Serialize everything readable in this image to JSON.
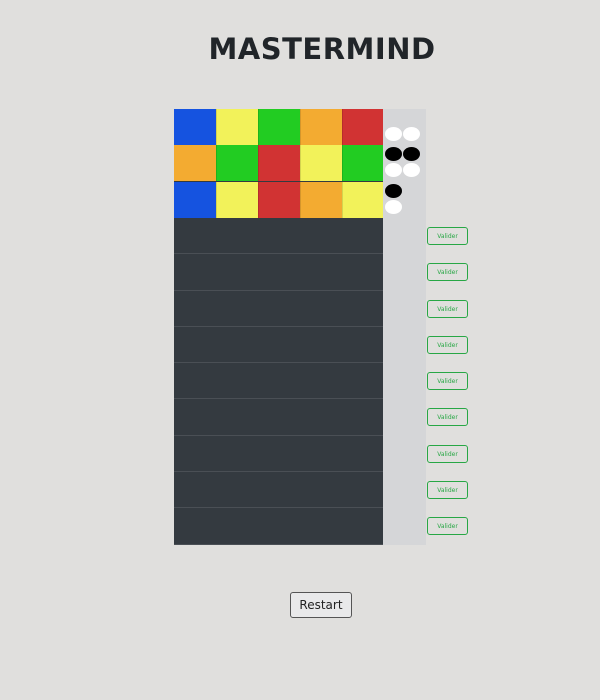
{
  "title": "MASTERMIND",
  "colors": {
    "blue": "#1553e0",
    "yellow": "#f2f25a",
    "green": "#22cc22",
    "orange": "#f3ab31",
    "red": "#d13333",
    "board_bg": "#343a40",
    "feedback_bg": "#d5d6d8",
    "peg_black": "#000000",
    "peg_white": "#ffffff",
    "valider_accent": "#28a745"
  },
  "guesses": [
    {
      "pegs": [
        "blue",
        "yellow",
        "green",
        "orange",
        "red"
      ],
      "feedback": {
        "black": 0,
        "white": 2
      }
    },
    {
      "pegs": [
        "orange",
        "green",
        "red",
        "yellow",
        "green"
      ],
      "feedback": {
        "black": 2,
        "white": 2
      }
    },
    {
      "pegs": [
        "blue",
        "yellow",
        "red",
        "orange",
        "yellow"
      ],
      "feedback": {
        "black": 1,
        "white": 1
      }
    }
  ],
  "empty_rows": 9,
  "valider_label": "Valider",
  "restart_label": "Restart"
}
